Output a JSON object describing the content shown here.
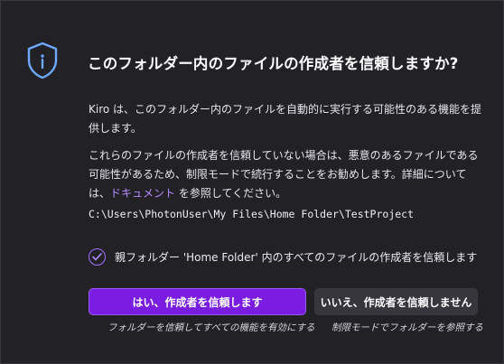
{
  "dialog": {
    "title": "このフォルダー内のファイルの作成者を信頼しますか?",
    "icon": "shield-icon",
    "paragraph1": "Kiro は、このフォルダー内のファイルを自動的に実行する可能性のある機能を提供します。",
    "paragraph2_before": "これらのファイルの作成者を信頼していない場合は、悪意のあるファイルである可能性があるため、制限モードで続行することをお勧めします。詳細については、",
    "paragraph2_link": "ドキュメント",
    "paragraph2_after": " を参照してください。",
    "path": "C:\\Users\\PhotonUser\\My Files\\Home Folder\\TestProject",
    "checkbox_label": "親フォルダー 'Home Folder' 内のすべてのファイルの作成者を信頼します",
    "checkbox_checked": true,
    "primary_button": "はい、作成者を信頼します",
    "primary_hint": "フォルダーを信頼してすべての機能を有効にする",
    "secondary_button": "いいえ、作成者を信頼しません",
    "secondary_hint": "制限モードでフォルダーを参照する"
  },
  "colors": {
    "background": "#222126",
    "accent": "#7a1de0",
    "link": "#b78cff",
    "shield": "#6ea8ff"
  }
}
